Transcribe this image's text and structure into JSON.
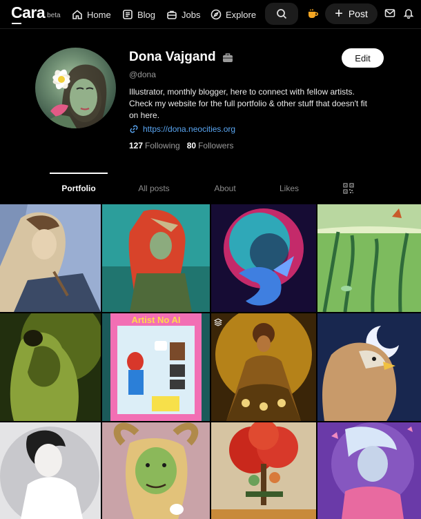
{
  "nav": {
    "logo": "Cara",
    "logo_badge": "beta",
    "items": [
      {
        "label": "Home",
        "icon": "home-icon"
      },
      {
        "label": "Blog",
        "icon": "blog-icon"
      },
      {
        "label": "Jobs",
        "icon": "jobs-icon"
      },
      {
        "label": "Explore",
        "icon": "compass-icon"
      }
    ],
    "post_label": "Post",
    "accent_color": "#f5a623"
  },
  "profile": {
    "name": "Dona Vajgand",
    "handle": "@dona",
    "bio_lines": [
      "Illustrator, monthly blogger, here to connect with fellow artists.",
      "Check my website for the full portfolio & other stuff that doesn't fit on here."
    ],
    "link": "https://dona.neocities.org",
    "following_count": "127",
    "following_label": "Following",
    "followers_count": "80",
    "followers_label": "Followers",
    "edit_label": "Edit"
  },
  "tabs": [
    {
      "label": "Portfolio",
      "active": true
    },
    {
      "label": "All posts",
      "active": false
    },
    {
      "label": "About",
      "active": false
    },
    {
      "label": "Likes",
      "active": false
    }
  ],
  "gallery": {
    "tiles": [
      {
        "subject": "man with brush in workshop",
        "colors": [
          "#8fa3c9",
          "#d8c3a1",
          "#3a4e6a"
        ]
      },
      {
        "subject": "red-haired woman shading eyes",
        "colors": [
          "#2fa3a0",
          "#e44b2a",
          "#1b6f6a"
        ]
      },
      {
        "subject": "cosmic dragon with planet",
        "colors": [
          "#1a0f3a",
          "#d6317a",
          "#3fb7c9"
        ]
      },
      {
        "subject": "underwater grassland",
        "colors": [
          "#7ab35a",
          "#2f6b3a",
          "#c8d98a"
        ]
      },
      {
        "subject": "embracing figures in green",
        "colors": [
          "#2b3a12",
          "#8fa52c",
          "#101806"
        ]
      },
      {
        "subject": "artist starter pack toy box",
        "colors": [
          "#7ad0e8",
          "#f07ab5",
          "#ffffff"
        ]
      },
      {
        "subject": "woman in golden dress",
        "colors": [
          "#3a2608",
          "#d69a1f",
          "#f0d27a"
        ]
      },
      {
        "subject": "griffin under crescent moon",
        "colors": [
          "#1a2b57",
          "#c89a6a",
          "#e8e0d0"
        ]
      },
      {
        "subject": "pale figure portrait",
        "colors": [
          "#d9d9dc",
          "#ffffff",
          "#2a2a2a"
        ]
      },
      {
        "subject": "horned green faun",
        "colors": [
          "#c9a3a8",
          "#8bb85a",
          "#d8b06a"
        ]
      },
      {
        "subject": "couple under red tree",
        "colors": [
          "#d5c2a0",
          "#c9281c",
          "#3a5b2a"
        ]
      },
      {
        "subject": "pink-haired elf",
        "colors": [
          "#7a4ab8",
          "#e86aa0",
          "#c0d8f0"
        ]
      }
    ]
  }
}
